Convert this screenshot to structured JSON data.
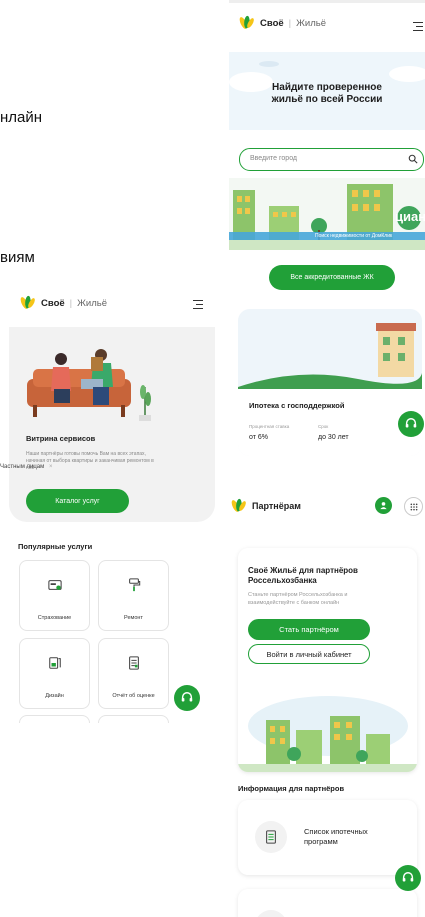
{
  "fragments": {
    "online": "нлайн",
    "conditions": "виям",
    "private_persons": "Частным лицам",
    "private_persons_close": "×"
  },
  "brand": {
    "main": "Своё",
    "separator": "|",
    "sub": "Жильё"
  },
  "hero": {
    "title_line1": "Найдите проверенное",
    "title_line2": "жильё по всей России",
    "search_placeholder": "Введите город",
    "cian_text": "циан",
    "cian_subtext": "Поиск недвижимости от ДомКлик",
    "all_accredited_button": "Все аккредитованные ЖК"
  },
  "mortgage_card": {
    "title": "Ипотека с господдержкой",
    "rate_label": "Процентная ставка",
    "rate_value": "от 6%",
    "term_label": "Срок",
    "term_value": "до 30 лет"
  },
  "services": {
    "title": "Витрина сервисов",
    "description": "Наши партнёры готовы помочь Вам на всех этапах, начиная от выбора квартиры и заканчивая ремонтом в ней",
    "catalog_button": "Каталог услуг",
    "popular_title": "Популярные услуги",
    "items": [
      {
        "label": "Страхование",
        "icon": "insurance-icon"
      },
      {
        "label": "Ремонт",
        "icon": "paint-roller-icon"
      },
      {
        "label": "Дизайн",
        "icon": "design-icon"
      },
      {
        "label": "Отчёт об оценке",
        "icon": "report-icon"
      }
    ]
  },
  "partners": {
    "header_title": "Партнёрам",
    "title_line1": "Своё Жильё для партнёров",
    "title_line2": "Россельхозбанка",
    "description": "Станьте партнёром Россельхозбанка и взаимодействуйте с банком онлайн",
    "become_partner_button": "Стать партнёром",
    "login_button": "Войти в личный кабинет",
    "info_title": "Информация для партнёров",
    "list_card_title": "Список ипотечных программ"
  },
  "colors": {
    "accent": "#21a038",
    "logo_yellow": "#f5c518",
    "logo_green": "#21a038"
  }
}
